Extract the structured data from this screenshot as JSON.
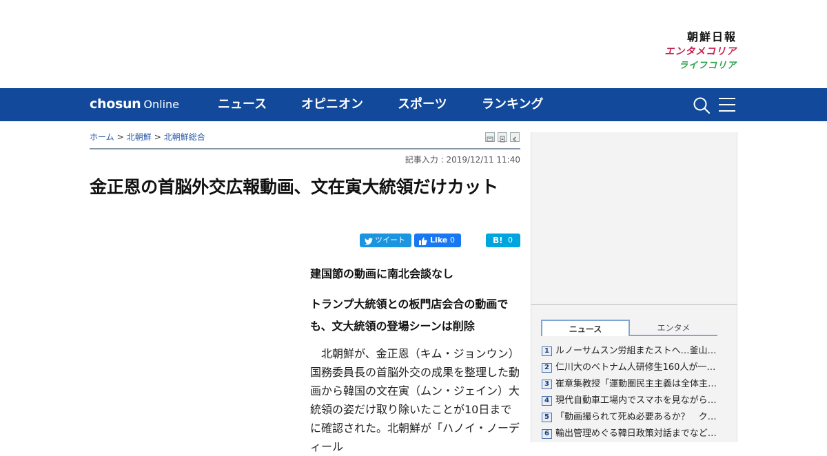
{
  "brands": {
    "chosun_nippo": "朝鮮日報",
    "entame_korea": "エンタメコリア",
    "life_korea": "ライフコリア"
  },
  "nav": {
    "logo_bold": "chosun",
    "logo_light": "Online",
    "items": [
      "ニュース",
      "オピニオン",
      "スポーツ",
      "ランキング"
    ],
    "search_icon": "search-icon",
    "menu_icon": "hamburger-menu-icon"
  },
  "breadcrumb": {
    "home": "ホーム",
    "section": "北朝鮮",
    "subsection": "北朝鮮総合",
    "separator": ">"
  },
  "article": {
    "timestamp": "記事入力 : 2019/12/11 11:40",
    "headline": "金正恩の首脳外交広報動画、文在寅大統領だけカット",
    "subhead_1": "建国節の動画に南北会談なし",
    "subhead_2": "トランプ大統領との板門店会合の動画でも、文大統領の登場シーンは削除",
    "body": "北朝鮮が、金正恩（キム・ジョンウン）国務委員長の首脳外交の成果を整理した動画から韓国の文在寅（ムン・ジェイン）大統領の姿だけ取り除いたことが10日までに確認された。北朝鮮が「ハノイ・ノーディール"
  },
  "share": {
    "tweet_label": "ツイート",
    "like_label": "Like",
    "like_count": "0",
    "hatena_label": "B!",
    "hatena_count": "0"
  },
  "sidebar": {
    "tabs": [
      "ニュース",
      "エンタメ"
    ],
    "active_tab": "ニュース",
    "ranking": [
      {
        "rank": "1",
        "title": "ルノーサムスン労組またストへ…釜山…"
      },
      {
        "rank": "2",
        "title": "仁川大のベトナム人研修生160人が一…"
      },
      {
        "rank": "3",
        "title": "崔章集教授「運動圏民主主義は全体主…"
      },
      {
        "rank": "4",
        "title": "現代自動車工場内でスマホを見ながら…"
      },
      {
        "rank": "5",
        "title": "「動画撮られて死ぬ必要あるか？　ク…"
      },
      {
        "rank": "6",
        "title": "輸出管理めぐる韓日政策対話までなど…"
      }
    ]
  },
  "colors": {
    "nav_bg": "#12499a",
    "entame_pink": "#c81e4e",
    "life_green": "#2aa14b",
    "twitter_blue": "#1b95e0",
    "facebook_blue": "#1877f2",
    "hatena_blue": "#00a4de"
  }
}
